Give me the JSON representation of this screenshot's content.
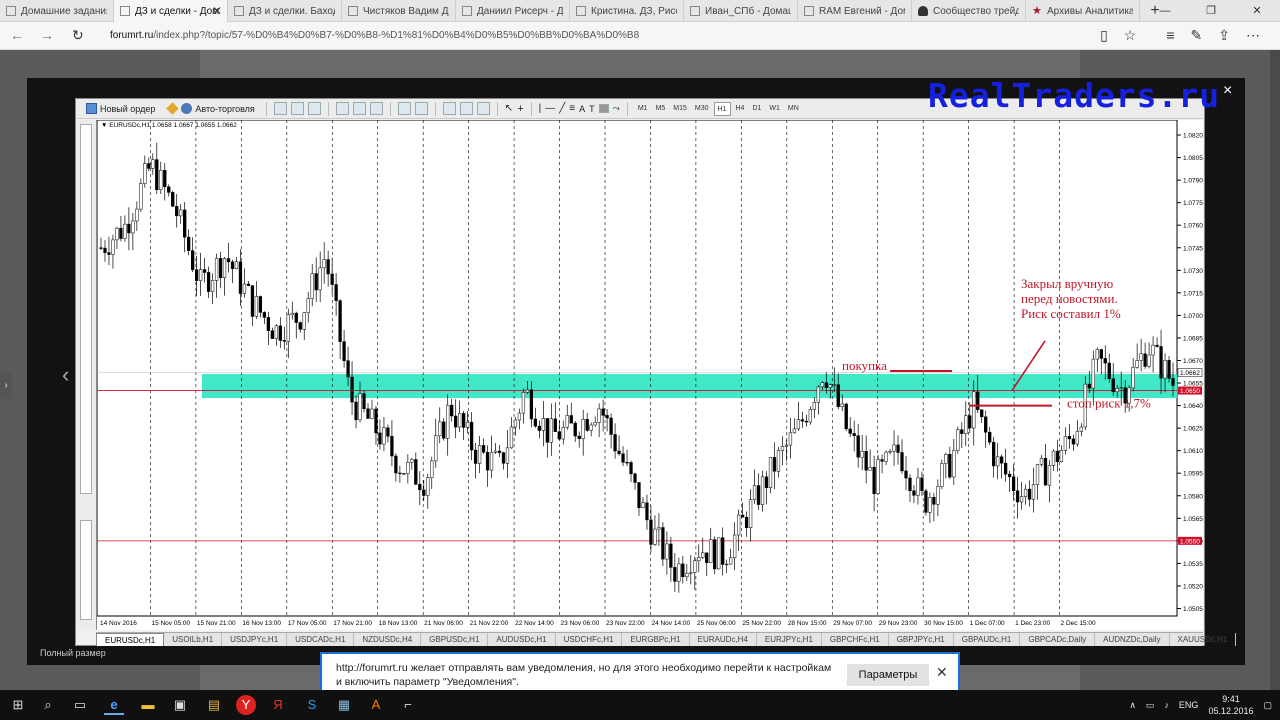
{
  "browser": {
    "tabs": [
      {
        "label": "Домашние задания и",
        "active": false,
        "icon": "page-icon"
      },
      {
        "label": "ДЗ и сделки - Дом",
        "active": true,
        "icon": "page-icon"
      },
      {
        "label": "ДЗ и сделки. Баходир",
        "active": false,
        "icon": "page-icon"
      },
      {
        "label": "Чистяков Вадим ДЗ -",
        "active": false,
        "icon": "page-icon"
      },
      {
        "label": "Даниил Рисерч - Дом",
        "active": false,
        "icon": "page-icon"
      },
      {
        "label": "Кристина. ДЗ, Рисерч",
        "active": false,
        "icon": "page-icon"
      },
      {
        "label": "Иван_СПб - Домашни",
        "active": false,
        "icon": "page-icon"
      },
      {
        "label": "RAM Евгений - Домаш",
        "active": false,
        "icon": "page-icon"
      },
      {
        "label": "Сообщество трейдер",
        "active": false,
        "icon": "person-icon"
      },
      {
        "label": "Архивы Аналитика - F",
        "active": false,
        "icon": "star-icon"
      }
    ],
    "new_tab": "+",
    "url_host": "forumrt.ru",
    "url_rest": "/index.php?/topic/57-%D0%B4%D0%B7-%D0%B8-%D1%81%D0%B4%D0%B5%D0%BB%D0%BA%D0%B8"
  },
  "lightbox": {
    "fullsize_label": "Полный размер",
    "close": "×"
  },
  "watermark": "RealTraders.ru",
  "mt4": {
    "new_order": "Новый ордер",
    "autotrading": "Авто-торговля",
    "timeframes": [
      "M1",
      "M5",
      "M15",
      "M30",
      "H1",
      "H4",
      "D1",
      "W1",
      "MN"
    ],
    "active_timeframe": "H1",
    "symbol_info": "EURUSDc,H1  1.0658 1.0667 1.0655 1.0662",
    "symbol_tabs": [
      "EURUSDc,H1",
      "USOILb,H1",
      "USDJPYc,H1",
      "USDCADc,H1",
      "NZDUSDc,H4",
      "GBPUSDc,H1",
      "AUDUSDc,H1",
      "USDCHFc,H1",
      "EURGBPc,H1",
      "EURAUDc,H4",
      "EURJPYc,H1",
      "GBPCHFc,H1",
      "GBPJPYc,H1",
      "GBPAUDc,H1",
      "GBPCADc,Daily",
      "AUDNZDc,Daily",
      "XAUUSDc,H1"
    ],
    "active_symbol": "EURUSDc,H1"
  },
  "chart_data": {
    "type": "candlestick",
    "y_ticks": [
      "1.0820",
      "1.0805",
      "1.0790",
      "1.0775",
      "1.0760",
      "1.0745",
      "1.0730",
      "1.0715",
      "1.0700",
      "1.0685",
      "1.0670",
      "1.0655",
      "1.0640",
      "1.0625",
      "1.0610",
      "1.0595",
      "1.0580",
      "1.0565",
      "1.0550",
      "1.0535",
      "1.0520",
      "1.0505"
    ],
    "x_ticks": [
      "14 Nov 2016",
      "15 Nov 05:00",
      "15 Nov 21:00",
      "16 Nov 13:00",
      "17 Nov 05:00",
      "17 Nov 21:00",
      "18 Nov 13:00",
      "21 Nov 06:00",
      "21 Nov 22:00",
      "22 Nov 14:00",
      "23 Nov 06:00",
      "23 Nov 22:00",
      "24 Nov 14:00",
      "25 Nov 06:00",
      "25 Nov 22:00",
      "28 Nov 15:00",
      "29 Nov 07:00",
      "29 Nov 23:00",
      "30 Nov 15:00",
      "1 Dec 07:00",
      "1 Dec 23:00",
      "2 Dec 15:00"
    ],
    "ylim": [
      1.05,
      1.083
    ],
    "close_path": [
      1.0745,
      1.076,
      1.08,
      1.077,
      1.072,
      1.074,
      1.071,
      1.069,
      1.07,
      1.074,
      1.0645,
      1.0625,
      1.06,
      1.059,
      1.064,
      1.061,
      1.06,
      1.065,
      1.062,
      1.0625,
      1.064,
      1.06,
      1.056,
      1.053,
      1.0545,
      1.054,
      1.057,
      1.06,
      1.0625,
      1.0665,
      1.062,
      1.059,
      1.061,
      1.0575,
      1.06,
      1.064,
      1.06,
      1.058,
      1.06,
      1.062,
      1.067,
      1.065,
      1.068,
      1.0655
    ],
    "current_price": "1.0662",
    "stop_price": "1.0650",
    "support_price": "1.0550",
    "zone": [
      1.0645,
      1.0661
    ],
    "annotations": {
      "buy": "покупка",
      "stop": "стоп риск 1,7%",
      "closed": [
        "Закрыл вручную",
        "перед новостями.",
        "Риск составил 1%"
      ]
    },
    "colors": {
      "zone": "#40e8c8",
      "annotation": "#c0172b",
      "line": "#d0102a"
    }
  },
  "notification": {
    "text": "http://forumrt.ru желает отправлять вам уведомления, но для этого необходимо перейти к настройкам и включить параметр \"Уведомления\".",
    "button": "Параметры",
    "close": "✕"
  },
  "taskbar": {
    "lang": "ENG",
    "time": "9:41",
    "date": "05.12.2016"
  }
}
